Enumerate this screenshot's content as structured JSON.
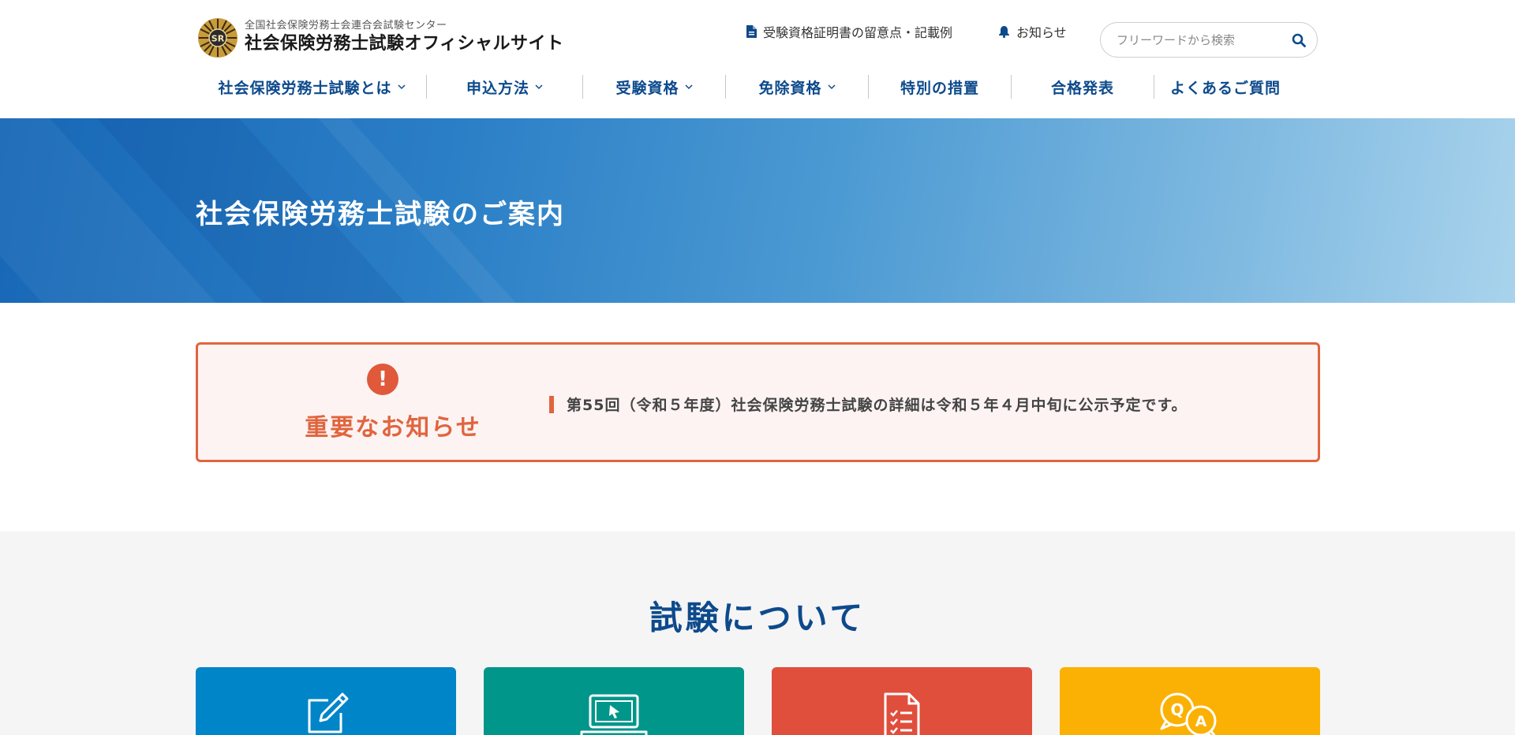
{
  "header": {
    "logo_sub": "全国社会保険労務士会連合会試験センター",
    "logo_main": "社会保険労務士試験オフィシャルサイト",
    "logo_emblem_text": "SR",
    "util_cert": "受験資格証明書の留意点・記載例",
    "util_news": "お知らせ",
    "search_placeholder": "フリーワードから検索"
  },
  "nav": [
    {
      "label": "社会保険労務士試験とは",
      "has_dropdown": true
    },
    {
      "label": "申込方法",
      "has_dropdown": true
    },
    {
      "label": "受験資格",
      "has_dropdown": true
    },
    {
      "label": "免除資格",
      "has_dropdown": true
    },
    {
      "label": "特別の措置",
      "has_dropdown": false
    },
    {
      "label": "合格発表",
      "has_dropdown": false
    },
    {
      "label": "よくあるご質問",
      "has_dropdown": false
    }
  ],
  "hero": {
    "title": "社会保険労務士試験のご案内"
  },
  "notice": {
    "icon_text": "!",
    "title": "重要なお知らせ",
    "message": "第55回（令和５年度）社会保険労務士試験の詳細は令和５年４月中旬に公示予定です。"
  },
  "about": {
    "title": "試験について",
    "cards": [
      {
        "icon": "pencil-form-icon",
        "color": "#0085c9"
      },
      {
        "icon": "laptop-cursor-icon",
        "color": "#00968a"
      },
      {
        "icon": "checklist-document-icon",
        "color": "#e04e3c"
      },
      {
        "icon": "qa-bubbles-icon",
        "color": "#fbb104"
      }
    ]
  },
  "colors": {
    "brand_blue": "#0d4a8c",
    "accent_orange": "#e0653e",
    "notice_bg": "#fdf3f3"
  }
}
